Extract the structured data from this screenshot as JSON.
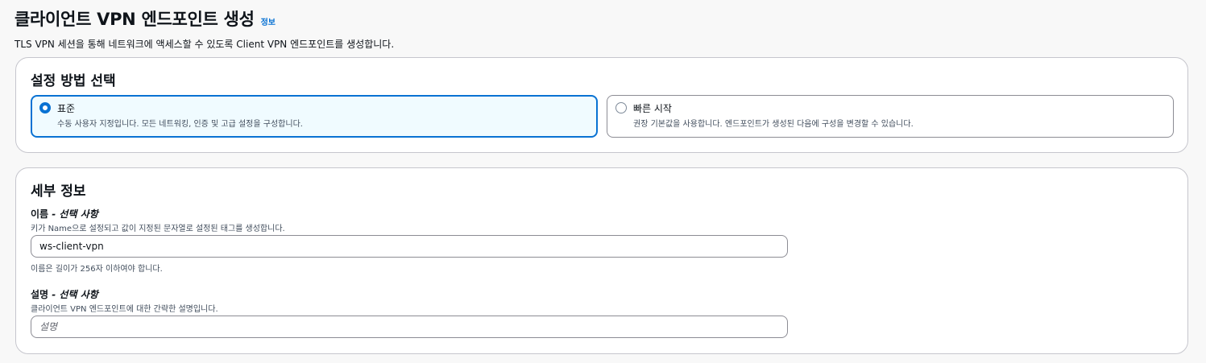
{
  "header": {
    "title": "클라이언트 VPN 엔드포인트 생성",
    "info_link": "정보",
    "description": "TLS VPN 세션을 통해 네트워크에 액세스할 수 있도록 Client VPN 엔드포인트를 생성합니다."
  },
  "setup": {
    "title": "설정 방법 선택",
    "options": [
      {
        "label": "표준",
        "description": "수동 사용자 지정입니다. 모든 네트워킹, 인증 및 고급 설정을 구성합니다.",
        "selected": true
      },
      {
        "label": "빠른 시작",
        "description": "권장 기본값을 사용합니다. 엔드포인트가 생성된 다음에 구성을 변경할 수 있습니다.",
        "selected": false
      }
    ]
  },
  "details": {
    "title": "세부 정보",
    "name": {
      "label": "이름",
      "optional": " - 선택 사항",
      "description": "키가 Name으로 설정되고 값이 지정된 문자열로 설정된 태그를 생성합니다.",
      "value": "ws-client-vpn",
      "constraint": "이름은 길이가 256자 이하여야 합니다."
    },
    "desc": {
      "label": "설명",
      "optional": " - 선택 사항",
      "description": "클라이언트 VPN 엔드포인트에 대한 간략한 설명입니다.",
      "value": "",
      "placeholder": "설명"
    }
  },
  "colors": {
    "accent": "#0972d3",
    "selected_bg": "#f0fbff",
    "border": "#8c8c94"
  }
}
